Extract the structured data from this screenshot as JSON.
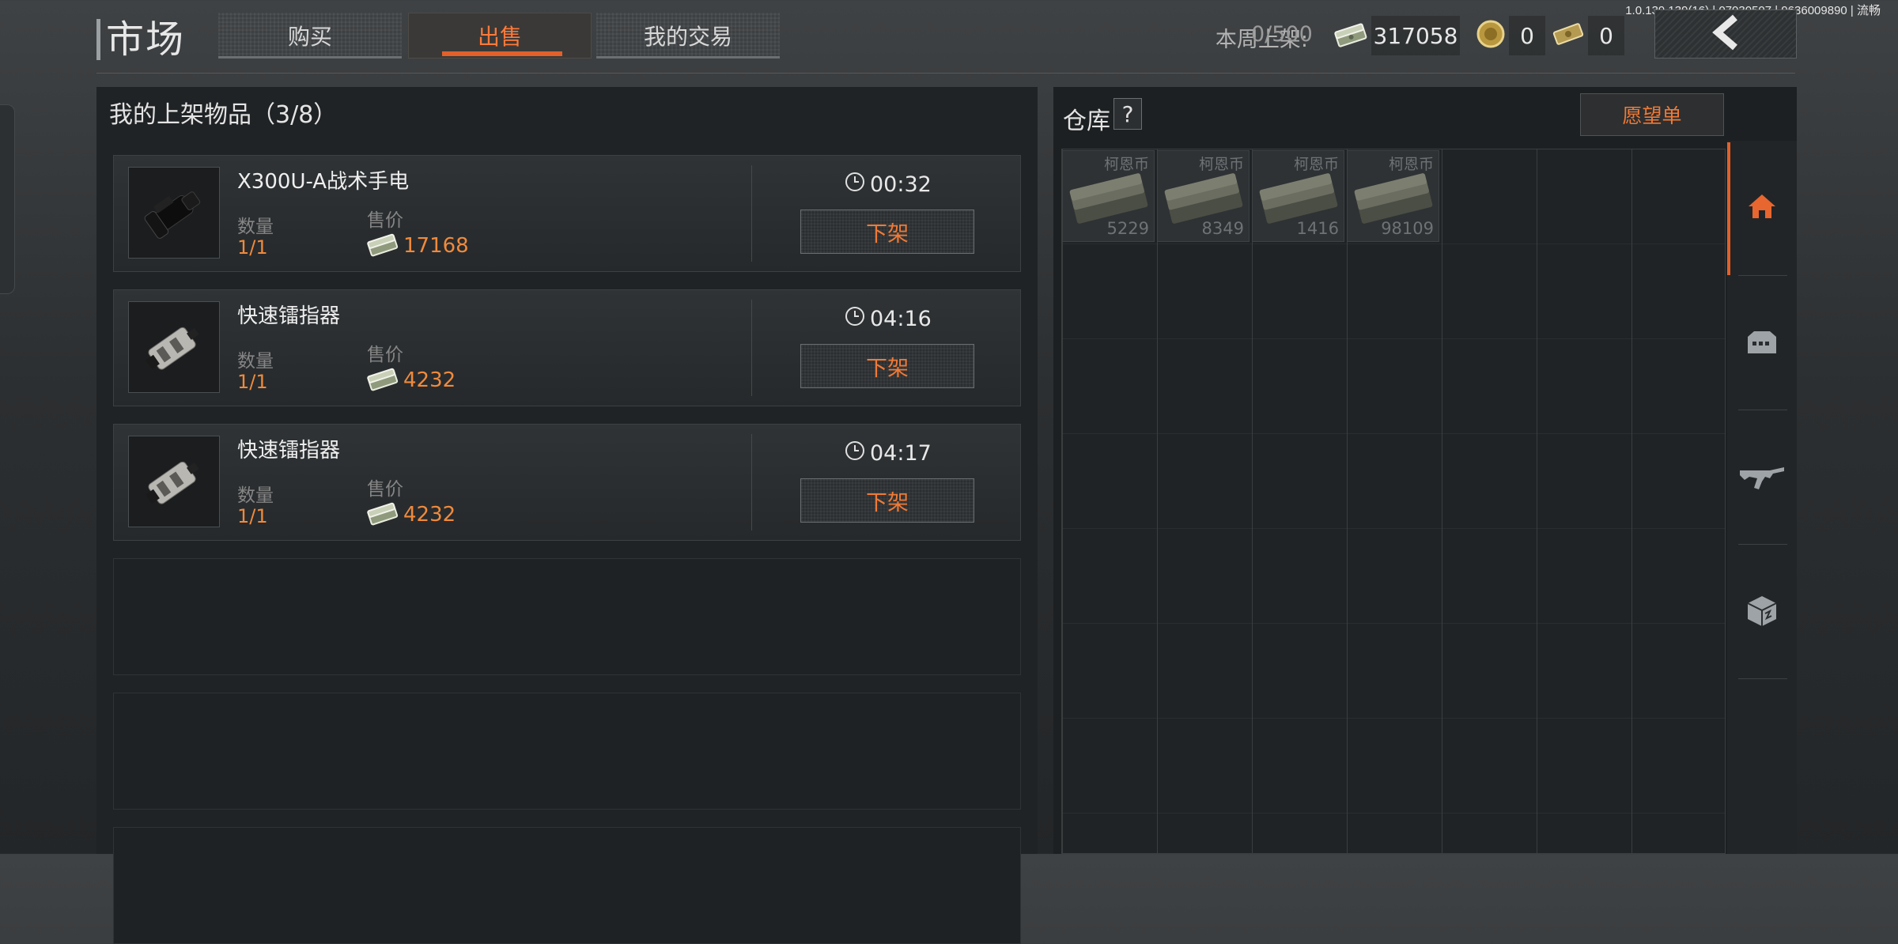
{
  "version": "1.0.139.139(16) | 07030507 | 9636009890 | 流畅",
  "header": {
    "title": "市场",
    "tabs": [
      {
        "label": "购买",
        "active": false
      },
      {
        "label": "出售",
        "active": true
      },
      {
        "label": "我的交易",
        "active": false
      }
    ],
    "weekly_listed_label": "本周上架:",
    "weekly_listed_value": "0/500",
    "currencies": [
      {
        "icon": "cash-stack-icon",
        "value": "317058"
      },
      {
        "icon": "gold-coin-icon",
        "value": "0"
      },
      {
        "icon": "gold-bills-icon",
        "value": "0"
      }
    ],
    "back_icon": "chevron-left-icon"
  },
  "my_listings": {
    "heading": "我的上架物品（3/8）",
    "qty_label": "数量",
    "price_label": "售价",
    "delist_label": "下架",
    "items": [
      {
        "name": "X300U-A战术手电",
        "qty": "1/1",
        "price": "17168",
        "time": "00:32",
        "icon": "tactical-flashlight-icon"
      },
      {
        "name": "快速镭指器",
        "qty": "1/1",
        "price": "4232",
        "time": "04:16",
        "icon": "laser-pointer-icon"
      },
      {
        "name": "快速镭指器",
        "qty": "1/1",
        "price": "4232",
        "time": "04:17",
        "icon": "laser-pointer-icon"
      }
    ]
  },
  "warehouse": {
    "title": "仓库",
    "help": "?",
    "wishlist_label": "愿望单",
    "items": [
      {
        "label": "柯恩币",
        "count": "5229"
      },
      {
        "label": "柯恩币",
        "count": "8349"
      },
      {
        "label": "柯恩币",
        "count": "1416"
      },
      {
        "label": "柯恩币",
        "count": "98109"
      }
    ]
  },
  "side_nav": [
    {
      "icon": "home-icon",
      "active": true
    },
    {
      "icon": "ammo-crate-icon",
      "active": false
    },
    {
      "icon": "rifle-icon",
      "active": false
    },
    {
      "icon": "supply-box-icon",
      "active": false
    }
  ],
  "colors": {
    "accent": "#e2602a",
    "price": "#f08a3c",
    "panel": "#202325"
  }
}
